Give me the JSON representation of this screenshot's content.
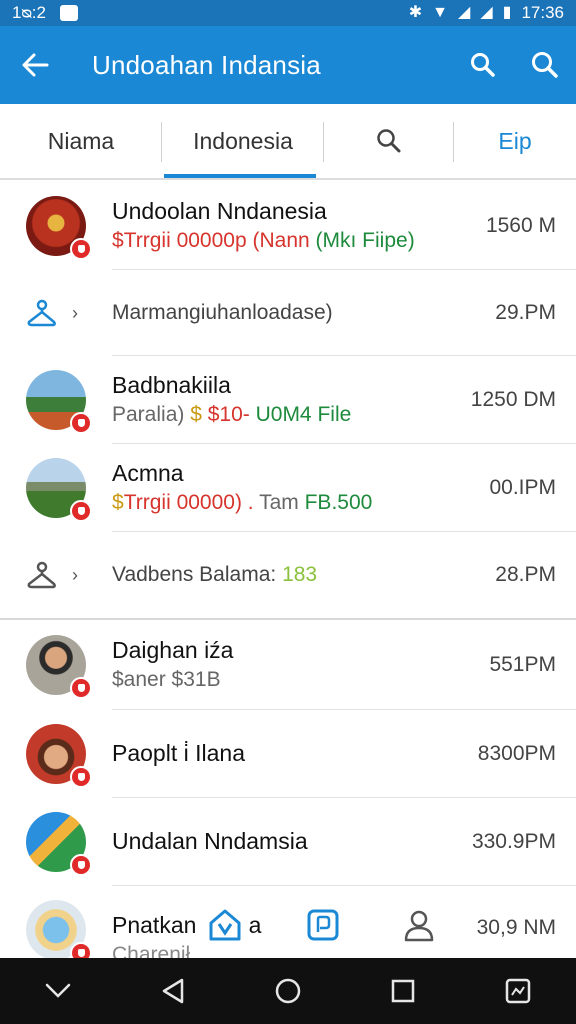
{
  "status_bar": {
    "time_left": "1ᴓ:2",
    "time_right": "17:36"
  },
  "app_bar": {
    "title": "Undoahan Indansia"
  },
  "tabs": [
    {
      "label": "Niama"
    },
    {
      "label": "Indonesia"
    },
    {
      "label": ""
    },
    {
      "label": "Eip"
    }
  ],
  "rows": [
    {
      "name": "Undoolan Nndanesia",
      "sub_parts": [
        "$",
        "Trrgii 00000p (Nann ",
        "(Mkı Fiipe)"
      ],
      "time": "1560 M"
    },
    {
      "single": "Marmangiuhanloadase)",
      "time": "29.PM"
    },
    {
      "name": "Badbnakiila",
      "sub_parts": [
        "Paralia) ",
        "$ ",
        "$10- ",
        "U0M4 File"
      ],
      "time": "1250 DM"
    },
    {
      "name": "Acmna",
      "sub_parts": [
        "$",
        "Trrgii 00000) . ",
        "Tam ",
        "FB.500"
      ],
      "time": "00.IPM"
    },
    {
      "single": "Vadbens Balama: ",
      "single_accent": "183",
      "time": "28.PM"
    },
    {
      "name": "Daighan iźa",
      "sub": "$aner $31B",
      "time": "551PM"
    },
    {
      "name": "Paoplt i̇ Ilana",
      "time": "8300PM"
    },
    {
      "name": "Undalan Nndamsia",
      "time": "330.9PM"
    },
    {
      "name": "Pnatkan",
      "name_tail": "a",
      "sub": "Charenił",
      "time": "30,9 NM"
    }
  ],
  "colors": {
    "primary": "#1a88d4",
    "status": "#1b73b8",
    "badge": "#e02a2a",
    "nav": "#101010"
  }
}
